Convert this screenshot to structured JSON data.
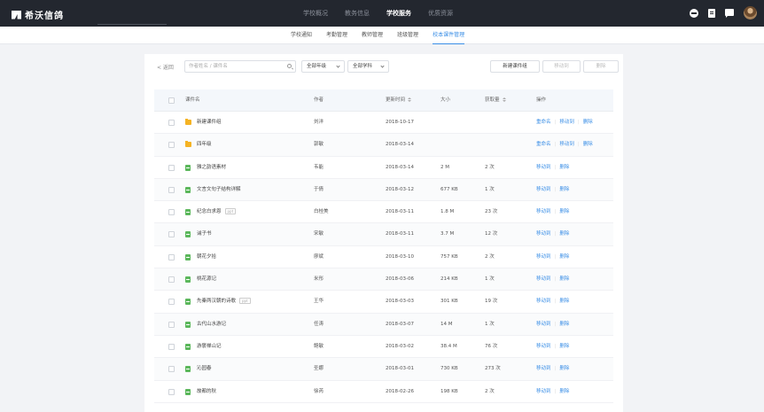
{
  "app": {
    "logo_text": "希沃信鸽"
  },
  "topnav": [
    "学校概况",
    "教务信息",
    "学校服务",
    "优质资源"
  ],
  "topnav_active": 2,
  "top_icons": [
    "minus-circle-icon",
    "document-icon",
    "message-icon",
    "avatar"
  ],
  "subnav": [
    "学校通知",
    "考勤管理",
    "教师管理",
    "班级管理",
    "校本课件管理"
  ],
  "subnav_active": 4,
  "toolbar": {
    "back_label": "< 返回",
    "search_placeholder": "作者姓名 / 课件名",
    "grade_select": "全部年级",
    "subject_select": "全部学科",
    "new_folder_label": "新建课件组",
    "move_label": "移动到",
    "delete_label": "删除"
  },
  "table": {
    "headers": {
      "name": "课件名",
      "author": "作者",
      "date": "更新时间",
      "size": "大小",
      "downloads": "获取量",
      "ops": "操作"
    },
    "rows": [
      {
        "type": "folder",
        "name": "新建课件组",
        "tag": "",
        "author": "刘洋",
        "date": "2018-10-17",
        "size": "",
        "downloads": "",
        "ops": [
          "重命名",
          "移动到",
          "删除"
        ]
      },
      {
        "type": "folder",
        "name": "四年级",
        "tag": "",
        "author": "郭敏",
        "date": "2018-03-14",
        "size": "",
        "downloads": "",
        "ops": [
          "重命名",
          "移动到",
          "删除"
        ]
      },
      {
        "type": "file",
        "name": "雅之韵语素材",
        "tag": "",
        "author": "韦能",
        "date": "2018-03-14",
        "size": "2 M",
        "downloads": "2 次",
        "ops": [
          "移动到",
          "删除"
        ]
      },
      {
        "type": "file",
        "name": "文言文句子结构详解",
        "tag": "",
        "author": "于倩",
        "date": "2018-03-12",
        "size": "677 KB",
        "downloads": "1 次",
        "ops": [
          "移动到",
          "删除"
        ]
      },
      {
        "type": "file",
        "name": "纪念白求恩",
        "tag": "ppt",
        "author": "白桂美",
        "date": "2018-03-11",
        "size": "1.8 M",
        "downloads": "23 次",
        "ops": [
          "移动到",
          "删除"
        ]
      },
      {
        "type": "file",
        "name": "诫子书",
        "tag": "",
        "author": "宋敏",
        "date": "2018-03-11",
        "size": "3.7 M",
        "downloads": "12 次",
        "ops": [
          "移动到",
          "删除"
        ]
      },
      {
        "type": "file",
        "name": "朝花夕拾",
        "tag": "",
        "author": "廖斌",
        "date": "2018-03-10",
        "size": "757 KB",
        "downloads": "2 次",
        "ops": [
          "移动到",
          "删除"
        ]
      },
      {
        "type": "file",
        "name": "桃花源记",
        "tag": "",
        "author": "米彤",
        "date": "2018-03-06",
        "size": "214 KB",
        "downloads": "1 次",
        "ops": [
          "移动到",
          "删除"
        ]
      },
      {
        "type": "file",
        "name": "先秦两汉朝的诗歌",
        "tag": "ppt",
        "author": "王华",
        "date": "2018-03-03",
        "size": "301 KB",
        "downloads": "19 次",
        "ops": [
          "移动到",
          "删除"
        ]
      },
      {
        "type": "file",
        "name": "古代山水游记",
        "tag": "",
        "author": "任涛",
        "date": "2018-03-07",
        "size": "14 M",
        "downloads": "1 次",
        "ops": [
          "移动到",
          "删除"
        ]
      },
      {
        "type": "file",
        "name": "游褒禅山记",
        "tag": "",
        "author": "鲍敏",
        "date": "2018-03-02",
        "size": "38.4 M",
        "downloads": "76 次",
        "ops": [
          "移动到",
          "删除"
        ]
      },
      {
        "type": "file",
        "name": "沁园春",
        "tag": "",
        "author": "圣娜",
        "date": "2018-03-01",
        "size": "730 KB",
        "downloads": "273 次",
        "ops": [
          "移动到",
          "删除"
        ]
      },
      {
        "type": "file",
        "name": "故都的秋",
        "tag": "",
        "author": "徐芮",
        "date": "2018-02-26",
        "size": "198 KB",
        "downloads": "2 次",
        "ops": [
          "移动到",
          "删除"
        ]
      }
    ]
  }
}
